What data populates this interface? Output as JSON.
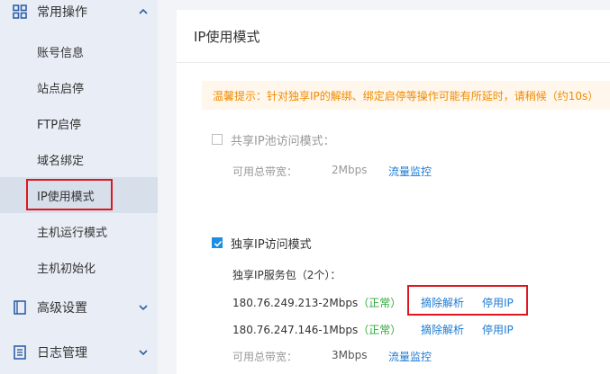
{
  "sidebar": {
    "groups": [
      {
        "label": "常用操作",
        "icon": "grid-icon",
        "expanded": true
      },
      {
        "label": "高级设置",
        "icon": "document-icon",
        "expanded": false
      },
      {
        "label": "日志管理",
        "icon": "list-icon",
        "expanded": false
      }
    ],
    "items": [
      {
        "label": "账号信息"
      },
      {
        "label": "站点启停"
      },
      {
        "label": "FTP启停"
      },
      {
        "label": "域名绑定"
      },
      {
        "label": "IP使用模式",
        "active": true
      },
      {
        "label": "主机运行模式"
      },
      {
        "label": "主机初始化"
      }
    ]
  },
  "panel": {
    "title": "IP使用模式",
    "notice": "温馨提示：针对独享IP的解绑、绑定启停等操作可能有所延时，请稍候（约10s）",
    "shared": {
      "label": "共享IP池访问模式：",
      "checked": false,
      "bandwidth_label": "可用总带宽：",
      "bandwidth_value": "2Mbps",
      "monitor_link": "流量监控"
    },
    "exclusive": {
      "label": "独享IP访问模式",
      "checked": true,
      "package_label": "独享IP服务包（2个）：",
      "ips": [
        {
          "address": "180.76.249.213-2Mbps",
          "status": "（正常）",
          "unbind": "摘除解析",
          "disable": "停用IP"
        },
        {
          "address": "180.76.247.146-1Mbps",
          "status": "（正常）",
          "unbind": "摘除解析",
          "disable": "停用IP"
        }
      ],
      "bandwidth_label": "可用总带宽：",
      "bandwidth_value": "3Mbps",
      "monitor_link": "流量监控"
    }
  },
  "colors": {
    "accent": "#1e8ee0",
    "link": "#1e7bd2",
    "highlight": "#e0161f",
    "notice_text": "#f08a00",
    "ok": "#2daa3a"
  }
}
